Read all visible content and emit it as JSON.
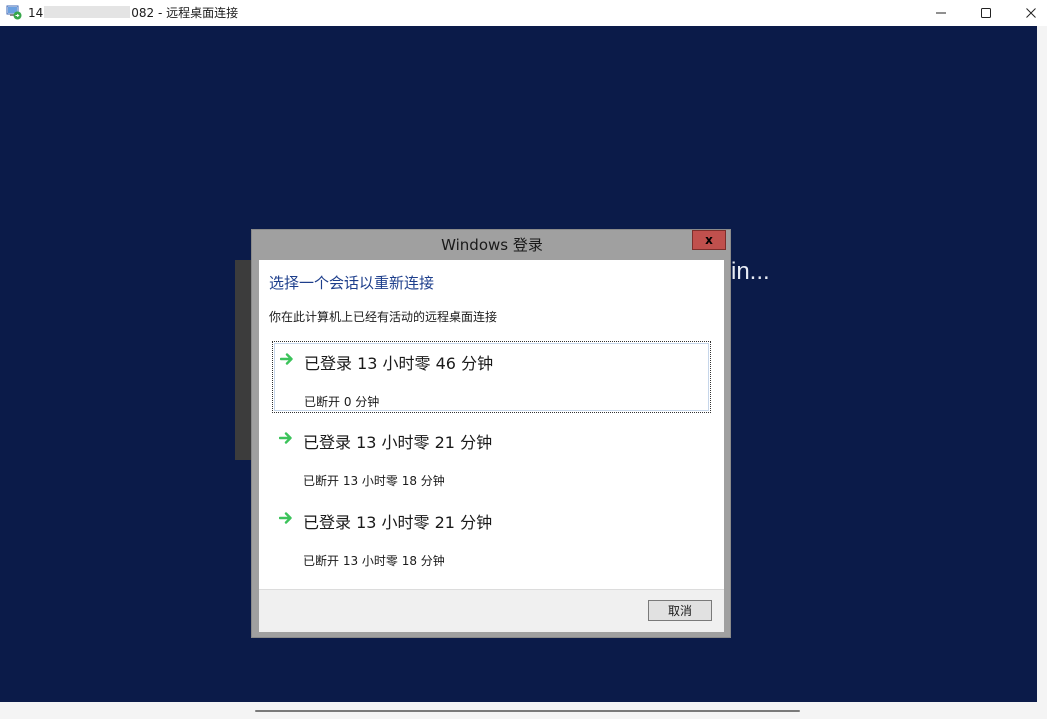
{
  "window": {
    "title_prefix": "14",
    "title_suffix": "082 - 远程桌面连接",
    "controls": [
      "minimize",
      "maximize",
      "close"
    ]
  },
  "background": {
    "signin_text": "in..."
  },
  "dialog": {
    "title": "Windows 登录",
    "close_glyph": "x",
    "heading": "选择一个会话以重新连接",
    "subtext": "你在此计算机上已经有活动的远程桌面连接",
    "sessions": [
      {
        "title": "已登录 13 小时零 46 分钟",
        "detail": "已断开 0 分钟",
        "selected": true
      },
      {
        "title": "已登录 13 小时零 21 分钟",
        "detail": "已断开 13 小时零 18 分钟",
        "selected": false
      },
      {
        "title": "已登录 13 小时零 21 分钟",
        "detail": "已断开 13 小时零 18 分钟",
        "selected": false
      }
    ],
    "cancel_label": "取消"
  },
  "colors": {
    "desktop_bg": "#0b1b49",
    "heading_blue": "#1e3f8c",
    "arrow_green": "#3cc35b",
    "close_red": "#c0504d"
  },
  "icons": {
    "app": "remote-desktop-icon",
    "session": "green-arrow-icon"
  }
}
